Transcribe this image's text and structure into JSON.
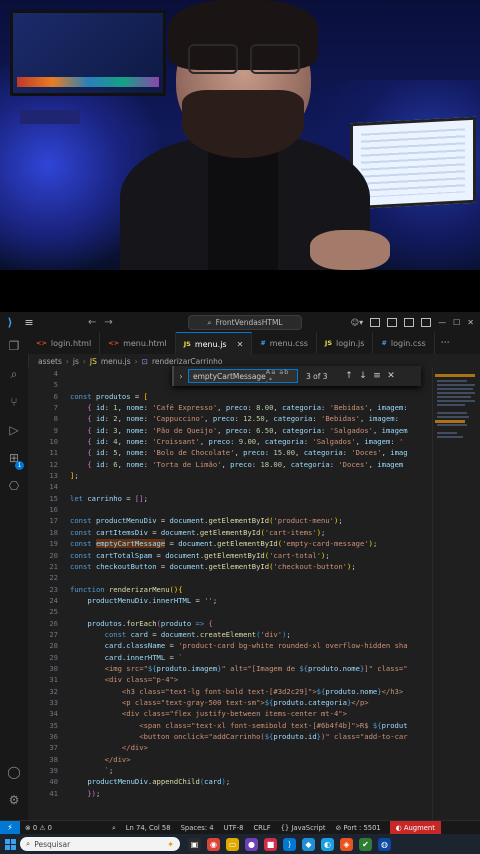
{
  "titlebar": {
    "search_text": "FrontVendasHTML"
  },
  "tabs": [
    {
      "icon": "html-file-icon",
      "label": "login.html",
      "type": "html",
      "active": false
    },
    {
      "icon": "html-file-icon",
      "label": "menu.html",
      "type": "html",
      "active": false
    },
    {
      "icon": "js-file-icon",
      "label": "menu.js",
      "type": "js",
      "active": true
    },
    {
      "icon": "css-file-icon",
      "label": "menu.css",
      "type": "css",
      "active": false
    },
    {
      "icon": "js-file-icon",
      "label": "login.js",
      "type": "js",
      "active": false
    },
    {
      "icon": "css-file-icon",
      "label": "login.css",
      "type": "css",
      "active": false
    }
  ],
  "breadcrumb": {
    "parts": [
      "assets",
      "js",
      "menu.js",
      "renderizarCarrinho"
    ]
  },
  "find": {
    "query": "emptyCartMessage",
    "options": "Aa ab .*",
    "count": "3 of 3"
  },
  "editor": {
    "line_numbers": [
      "4",
      "5",
      "6",
      "7",
      "8",
      "9",
      "10",
      "11",
      "12",
      "13",
      "14",
      "15",
      "16",
      "17",
      "18",
      "19",
      "20",
      "21",
      "22",
      "23",
      "24",
      "25",
      "26",
      "27",
      "28",
      "29",
      "30",
      "31",
      "32",
      "33",
      "34",
      "35",
      "36",
      "37",
      "38",
      "39",
      "40",
      "41"
    ]
  },
  "statusbar": {
    "errors": "0",
    "warnings": "0",
    "cursor": "Ln 74, Col 58",
    "spaces": "Spaces: 4",
    "encoding": "UTF-8",
    "eol": "CRLF",
    "language": "JavaScript",
    "port": "Port : 5501",
    "augment": "Augment"
  },
  "taskbar": {
    "search_placeholder": "Pesquisar"
  },
  "colors": {
    "accent": "#0078d4",
    "augment": "#c62828"
  }
}
